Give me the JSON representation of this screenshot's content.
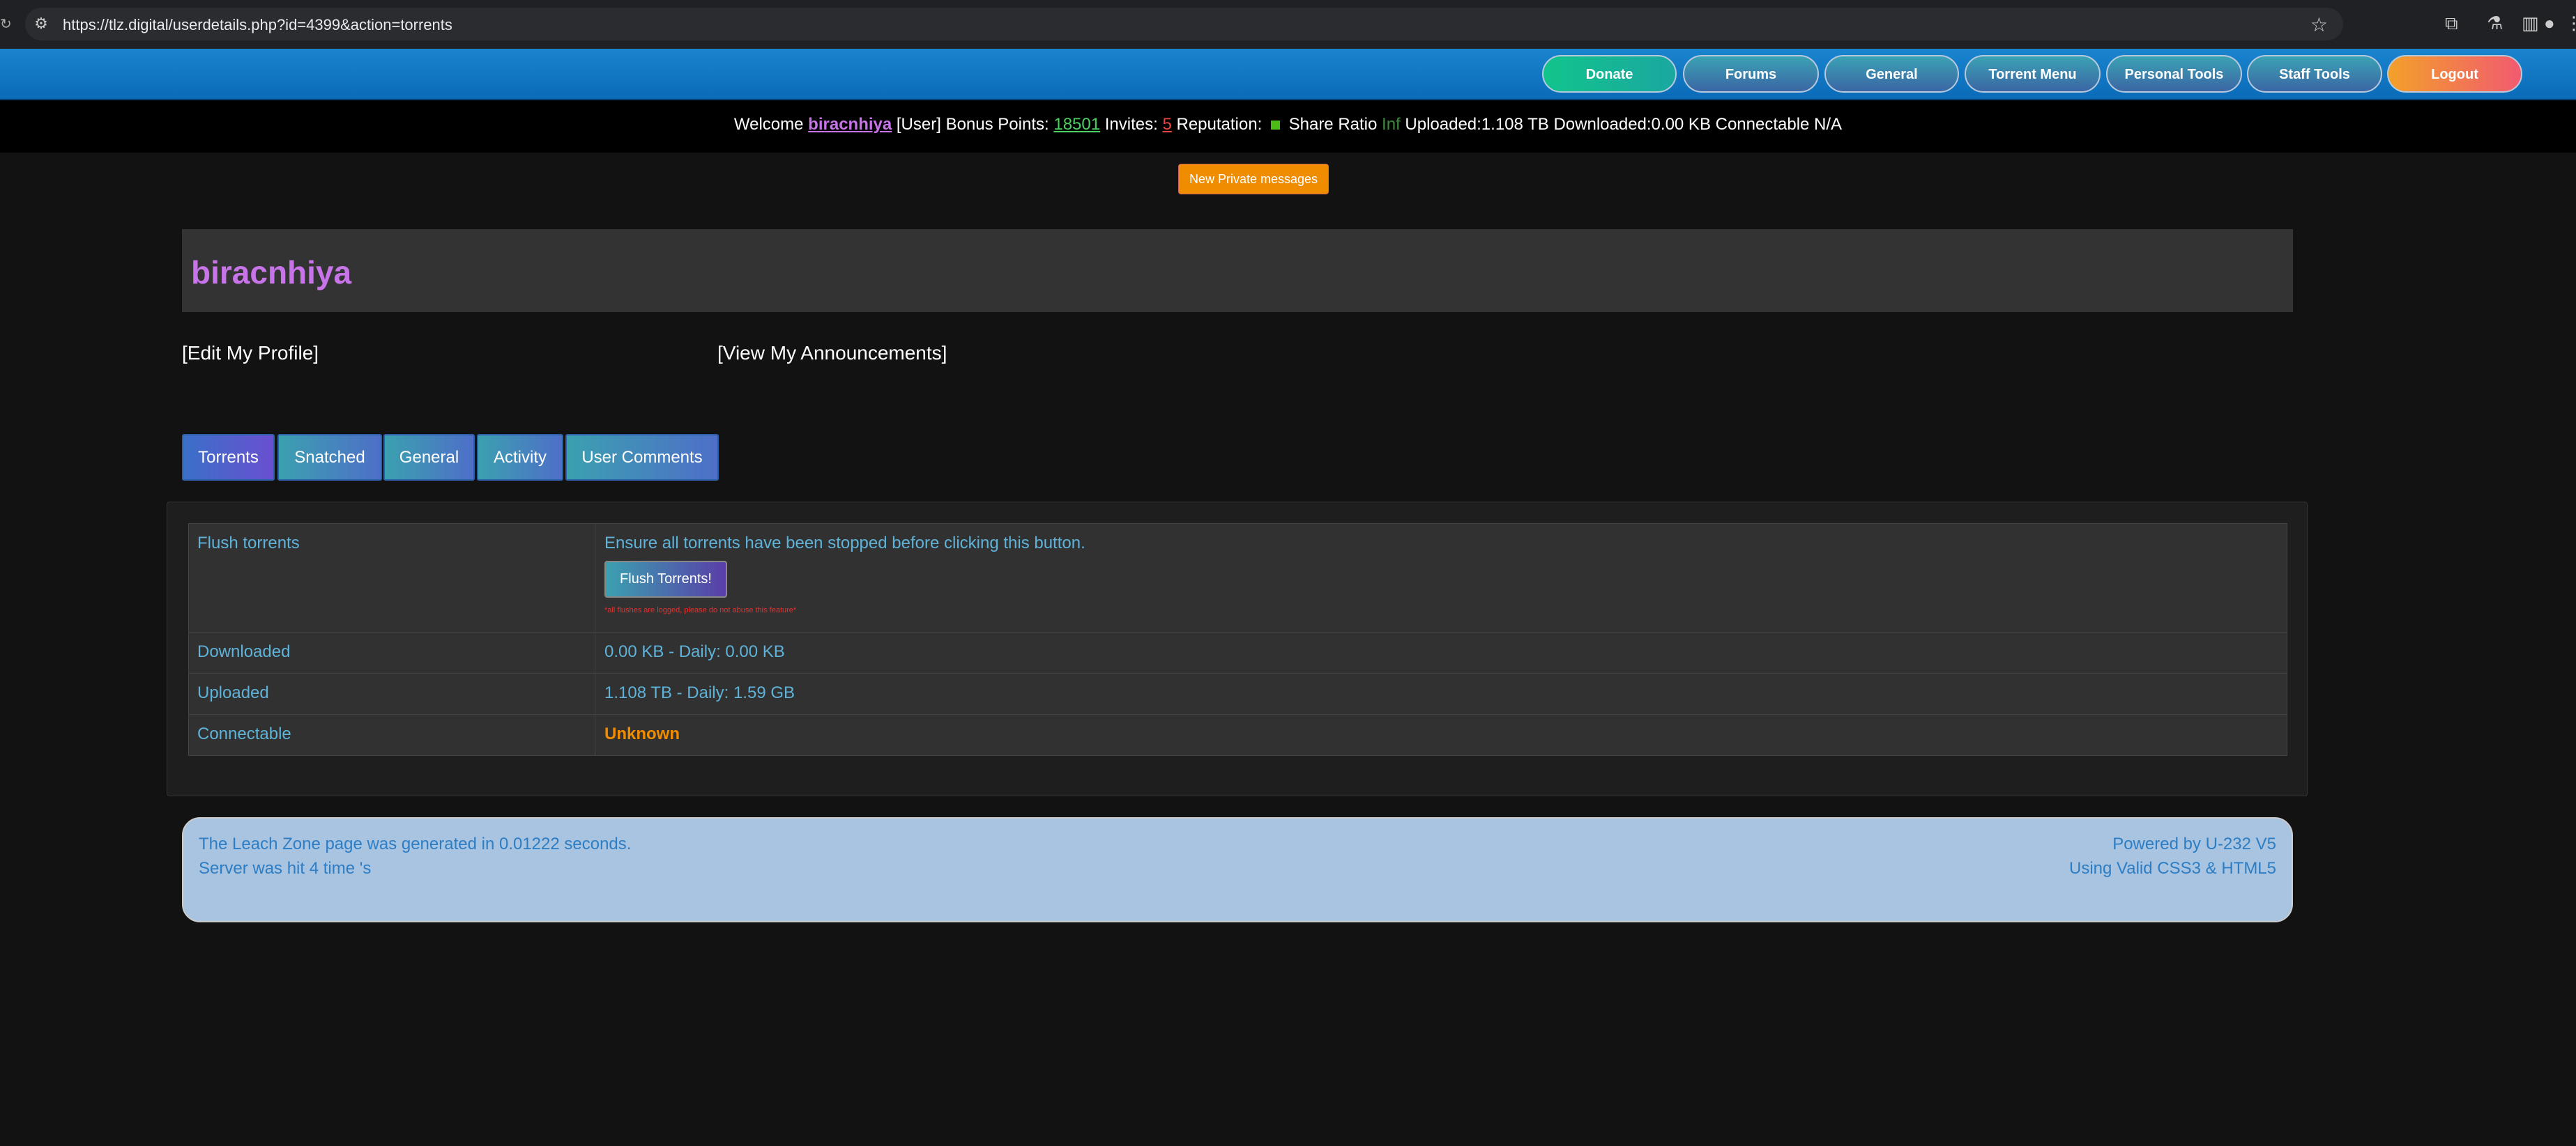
{
  "browser": {
    "url": "https://tlz.digital/userdetails.php?id=4399&action=torrents"
  },
  "nav": {
    "donate": "Donate",
    "forums": "Forums",
    "general": "General",
    "torrent_menu": "Torrent Menu",
    "personal_tools": "Personal Tools",
    "staff_tools": "Staff Tools",
    "logout": "Logout"
  },
  "welcome": {
    "prefix": "Welcome",
    "username": "biracnhiya",
    "role": "[User]",
    "bonus_label": "Bonus Points:",
    "bonus_value": "18501",
    "invites_label": "Invites:",
    "invites_value": "5",
    "reputation_label": "Reputation:",
    "share_ratio_label": "Share Ratio",
    "share_ratio_value": "Inf",
    "uploaded": "Uploaded:1.108 TB",
    "downloaded": "Downloaded:0.00 KB",
    "connectable": "Connectable N/A"
  },
  "pm_button": "New Private messages",
  "profile": {
    "name": "biracnhiya",
    "edit_link": "[Edit My Profile]",
    "announcements_link": "[View My Announcements]"
  },
  "tabs": [
    "Torrents",
    "Snatched",
    "General",
    "Activity",
    "User Comments"
  ],
  "details": {
    "flush_label": "Flush torrents",
    "flush_note": "Ensure all torrents have been stopped before clicking this button.",
    "flush_button": "Flush Torrents!",
    "flush_warning": "*all flushes are logged, please do not abuse this feature*",
    "downloaded_label": "Downloaded",
    "downloaded_value": "0.00 KB - Daily: 0.00 KB",
    "uploaded_label": "Uploaded",
    "uploaded_value": "1.108 TB - Daily: 1.59 GB",
    "connectable_label": "Connectable",
    "connectable_value": "Unknown"
  },
  "footer": {
    "generated": "The Leach Zone page was generated in 0.01222 seconds.",
    "hits": "Server was hit 4 time 's",
    "powered": "Powered by U-232 V5",
    "valid": "Using Valid CSS3 & HTML5"
  },
  "colors": {
    "nav_blue": "#0a6bb8",
    "username_purple": "#c774e8",
    "link_blue": "#5fb3d9",
    "accent_orange": "#f08c00"
  }
}
